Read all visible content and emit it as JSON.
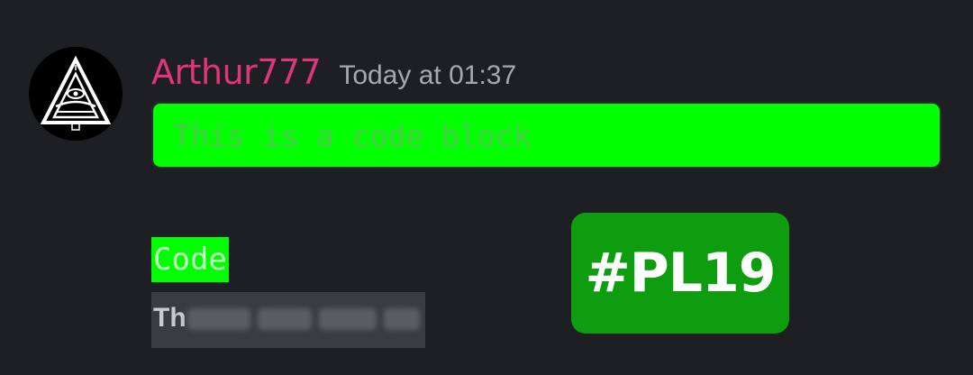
{
  "message": {
    "author": "Arthur777",
    "timestamp": "Today at 01:37",
    "code_block_text": "This is a code block",
    "inline_code_text": "Code",
    "redacted_visible_prefix": "Th",
    "badge_text": "#PL19"
  },
  "colors": {
    "username": "#e0357a",
    "code_block_bg": "#00ff00",
    "code_block_text": "#4ec94e",
    "inline_code_bg": "#00ff00",
    "inline_code_text": "#c8ffc8",
    "badge_bg": "#0f9d10",
    "badge_text": "#ffffff"
  },
  "icons": {
    "avatar": "triangle-eye-emblem-icon"
  }
}
